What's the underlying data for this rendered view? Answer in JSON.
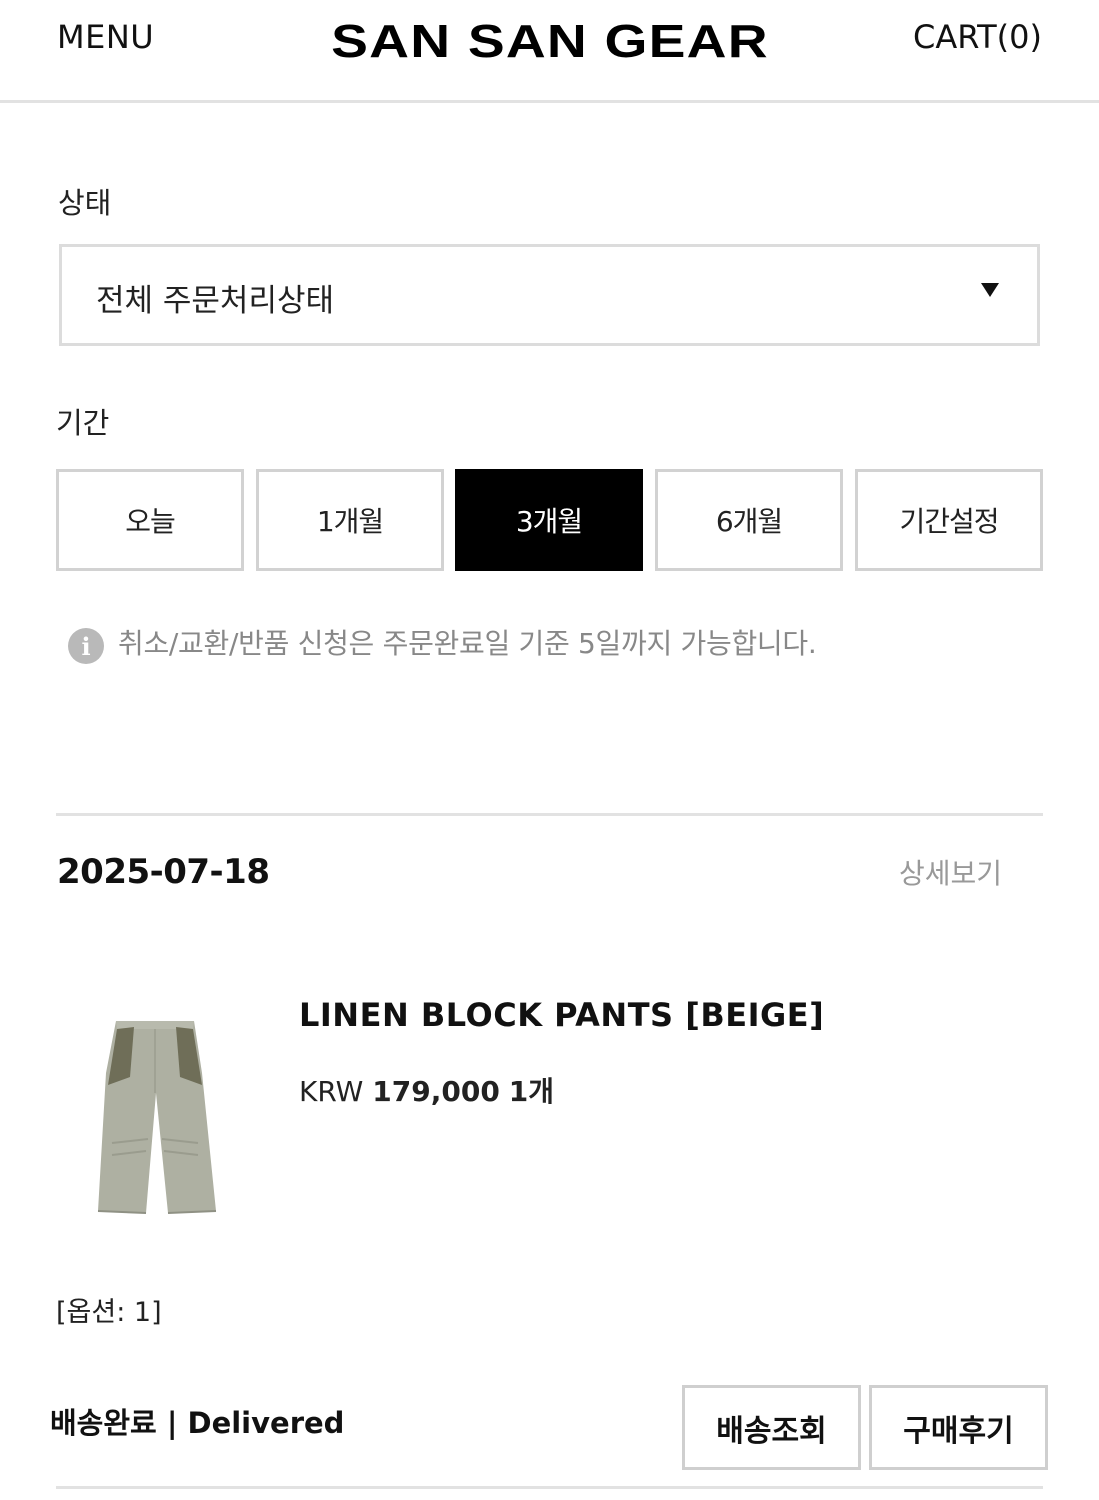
{
  "header": {
    "menu_label": "MENU",
    "logo_text": "SAN SAN GEAR",
    "cart_label": "CART(0)"
  },
  "filter": {
    "status_label": "상태",
    "status_select_value": "전체 주문처리상태",
    "period_label": "기간",
    "period_buttons": [
      {
        "label": "오늘",
        "active": false
      },
      {
        "label": "1개월",
        "active": false
      },
      {
        "label": "3개월",
        "active": true
      },
      {
        "label": "6개월",
        "active": false
      },
      {
        "label": "기간설정",
        "active": false
      }
    ],
    "notice_text": "취소/교환/반품 신청은 주문완료일 기준 5일까지 가능합니다."
  },
  "order": {
    "date": "2025-07-18",
    "detail_link": "상세보기",
    "product_name": "LINEN BLOCK PANTS [BEIGE]",
    "currency": "KRW",
    "price": "179,000",
    "quantity": "1개",
    "option": "[옵션: 1]",
    "delivery_status": "배송완료 | Delivered",
    "track_button": "배송조회",
    "review_button": "구매후기"
  },
  "colors": {
    "active_button_bg": "#000000",
    "border_gray": "#d2d2d2",
    "notice_gray": "#888888"
  },
  "icons": {
    "info": "info-icon",
    "dropdown": "caret-down-icon"
  }
}
